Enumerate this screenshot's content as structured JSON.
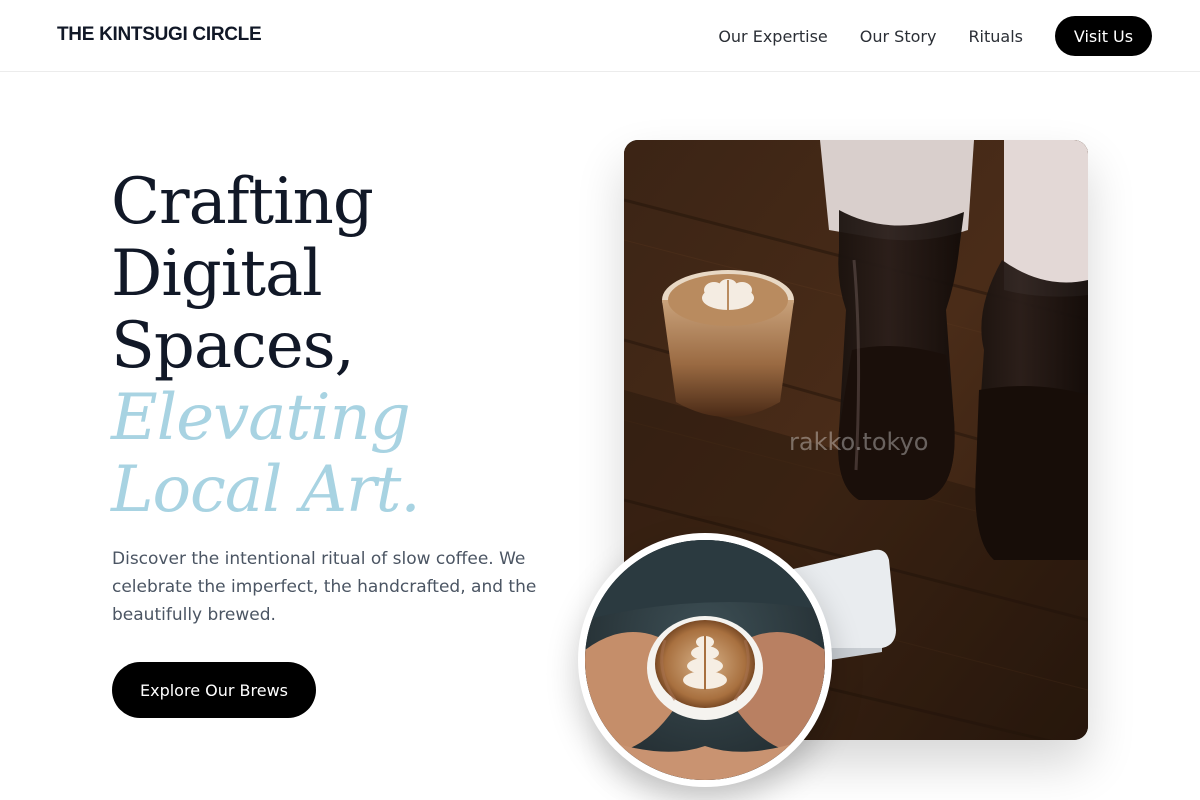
{
  "header": {
    "brand": "THE KINTSUGI CIRCLE",
    "nav": [
      {
        "label": "Our Expertise"
      },
      {
        "label": "Our Story"
      },
      {
        "label": "Rituals"
      }
    ],
    "cta_label": "Visit Us"
  },
  "hero": {
    "title_lines": [
      "Crafting",
      "Digital",
      "Spaces,"
    ],
    "accent_lines": [
      "Elevating",
      "Local Art."
    ],
    "accent_color": "#a8d3e2",
    "description": "Discover the intentional ritual of slow coffee. We celebrate the imperfect, the handcrafted, and the beautifully brewed.",
    "cta_label": "Explore Our Brews"
  },
  "media": {
    "main_photo_icon": "coffee-pour-over-photo",
    "main_photo_watermark": "rakko.tokyo",
    "circle_photo_icon": "latte-art-cup-photo"
  },
  "colors": {
    "button_bg": "#000000",
    "heading": "#111827",
    "body_text": "#4b5563"
  }
}
